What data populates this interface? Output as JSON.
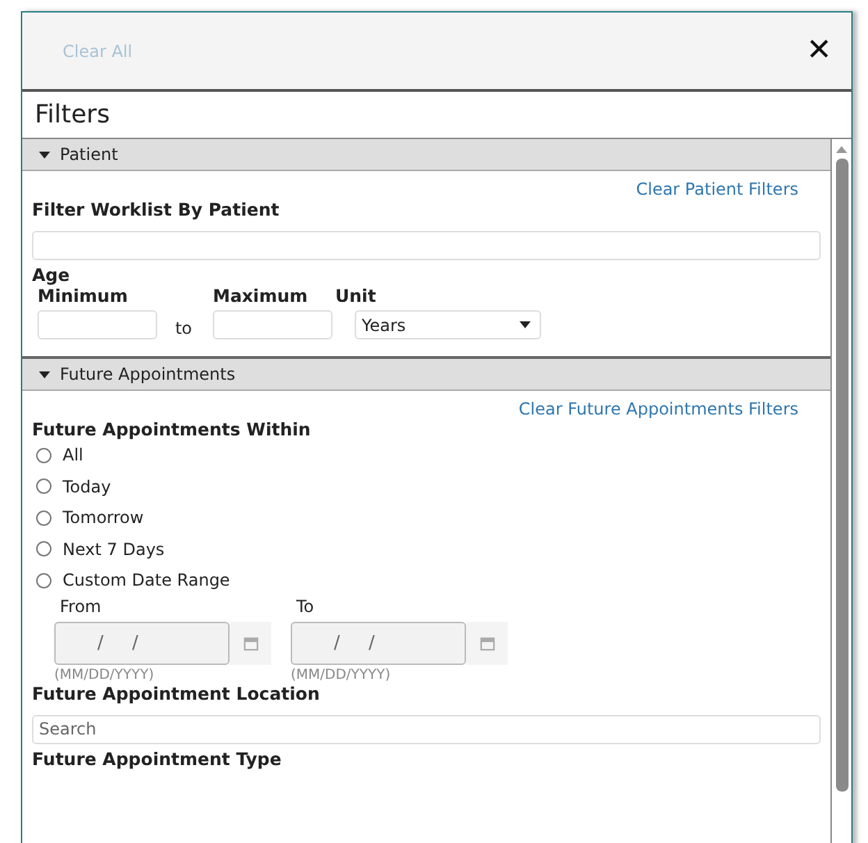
{
  "header": {
    "clear_all": "Clear All",
    "close": "✕"
  },
  "title": "Filters",
  "sections": [
    {
      "title": "Patient",
      "expanded": true,
      "kind": "patient",
      "clear_link": "Clear Patient Filters",
      "patient_label": "Filter Worklist By Patient",
      "age_label": "Age",
      "minimum_label": "Minimum",
      "maximum_label": "Maximum",
      "unit_label": "Unit",
      "to_label": "to",
      "unit_value": "Years"
    },
    {
      "title": "Future Appointments",
      "expanded": true,
      "kind": "appointments",
      "clear_link": "Clear Future Appointments Filters",
      "within_label": "Future Appointments Within",
      "options": [
        {
          "label": "All",
          "selected": false
        },
        {
          "label": "Today",
          "selected": false
        },
        {
          "label": "Tomorrow",
          "selected": false
        },
        {
          "label": "Next 7 Days",
          "selected": false
        },
        {
          "label": "Custom Date Range",
          "selected": false
        }
      ],
      "dates": [
        {
          "label": "From",
          "placeholder": "/     /",
          "hint": "(MM/DD/YYYY)"
        },
        {
          "label": "To",
          "placeholder": "/     /",
          "hint": "(MM/DD/YYYY)"
        }
      ],
      "location_label": "Future Appointment Location",
      "location_placeholder": "Search",
      "type_label": "Future Appointment Type"
    }
  ]
}
